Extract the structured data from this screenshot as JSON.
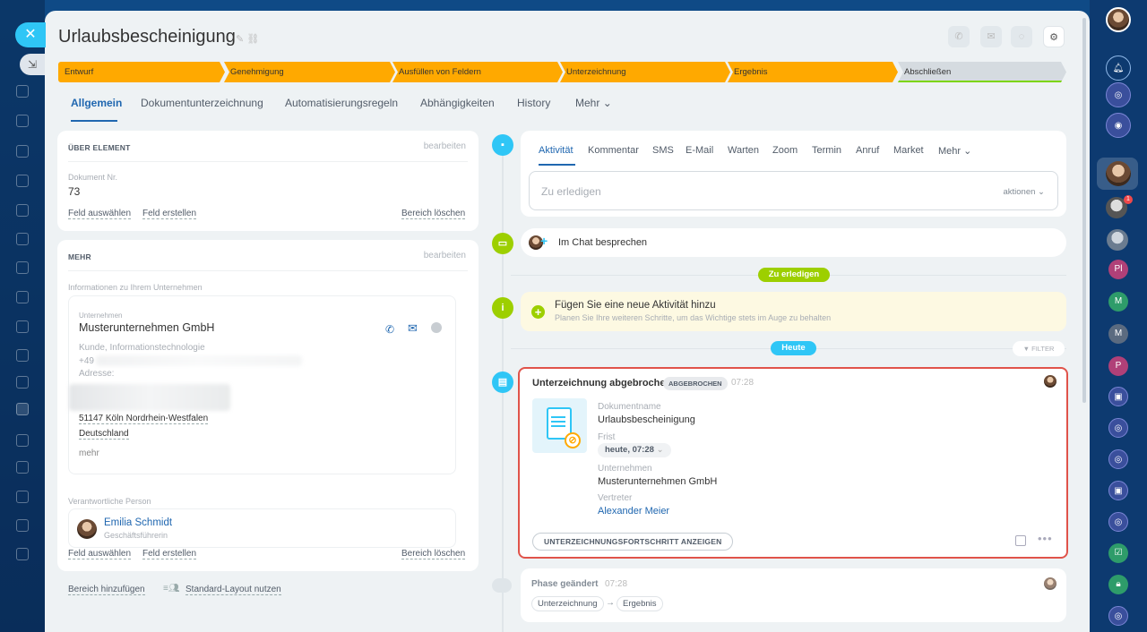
{
  "page": {
    "title": "Urlaubsbescheinigung"
  },
  "stages": [
    {
      "label": "Entwurf"
    },
    {
      "label": "Genehmigung"
    },
    {
      "label": "Ausfüllen von Feldern"
    },
    {
      "label": "Unterzeichnung"
    },
    {
      "label": "Ergebnis"
    },
    {
      "label": "Abschließen"
    }
  ],
  "tabs": {
    "allgemein": "Allgemein",
    "dokumentunterzeichnung": "Dokumentunterzeichnung",
    "automatisierungsregeln": "Automatisierungsregeln",
    "abhaengigkeiten": "Abhängigkeiten",
    "history": "History",
    "mehr": "Mehr"
  },
  "about": {
    "header": "ÜBER ELEMENT",
    "edit": "bearbeiten",
    "doc_label": "Dokument Nr.",
    "doc_value": "73",
    "select_field": "Feld auswählen",
    "create_field": "Feld erstellen",
    "delete_section": "Bereich löschen"
  },
  "more": {
    "header": "MEHR",
    "edit": "bearbeiten",
    "company_info_label": "Informationen zu Ihrem Unternehmen",
    "company_label": "Unternehmen",
    "company_name": "Musterunternehmen GmbH",
    "company_type": "Kunde, Informationstechnologie",
    "phone": "+49",
    "address_label": "Adresse:",
    "address_city": "51147 Köln Nordrhein-Westfalen",
    "address_country": "Deutschland",
    "more_link": "mehr",
    "responsible_label": "Verantwortliche Person",
    "person_name": "Emilia Schmidt",
    "person_role": "Geschäftsführerin",
    "select_field": "Feld auswählen",
    "create_field": "Feld erstellen",
    "delete_section": "Bereich löschen"
  },
  "footer_links": {
    "add_section": "Bereich hinzufügen",
    "standard_layout": "Standard-Layout nutzen"
  },
  "activity": {
    "tabs": [
      "Aktivität",
      "Kommentar",
      "SMS",
      "E-Mail",
      "Warten",
      "Zoom",
      "Termin",
      "Anruf",
      "Market",
      "Mehr"
    ],
    "todo_placeholder": "Zu erledigen",
    "actions": "aktionen",
    "chat": "Im Chat besprechen",
    "pill_todo": "Zu erledigen",
    "add_title": "Fügen Sie eine neue Aktivität hinzu",
    "add_sub": "Planen Sie Ihre weiteren Schritte, um das Wichtige stets im Auge zu behalten",
    "pill_today": "Heute",
    "filter": "FILTER"
  },
  "doc_event": {
    "title": "Unterzeichnung abgebrochen",
    "badge": "ABGEBROCHEN",
    "time": "07:28",
    "docname_label": "Dokumentname",
    "docname": "Urlaubsbescheinigung",
    "deadline_label": "Frist",
    "deadline": "heute, 07:28",
    "company_label": "Unternehmen",
    "company": "Musterunternehmen GmbH",
    "rep_label": "Vertreter",
    "rep": "Alexander Meier",
    "button": "UNTERZEICHNUNGSFORTSCHRITT ANZEIGEN"
  },
  "phase_event": {
    "title": "Phase geändert",
    "time": "07:28",
    "from": "Unterzeichnung",
    "arrow": "→",
    "to": "Ergebnis"
  },
  "right_rail": {
    "pl": "Pl",
    "m1": "M",
    "m2": "M",
    "p": "P",
    "badge": "1"
  },
  "colors": {
    "stage": "#ffa900",
    "accent": "#2067b0",
    "highlight": "#e0534a",
    "green": "#9dcf00",
    "cyan": "#2fc6f6"
  }
}
